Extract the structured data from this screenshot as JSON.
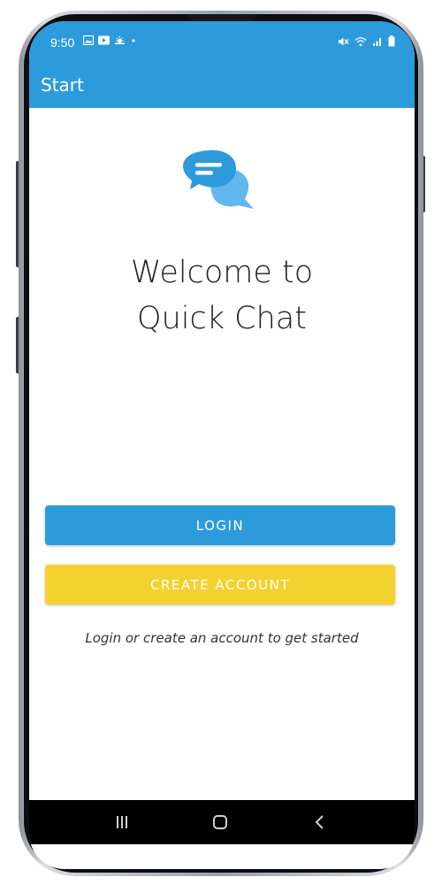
{
  "status_bar": {
    "time": "9:50",
    "icons_left": [
      "gallery-icon",
      "youtube-icon",
      "weather-icon",
      "dot-icon"
    ],
    "icons_right": [
      "mute-icon",
      "wifi-icon",
      "signal-icon",
      "battery-icon"
    ]
  },
  "app_bar": {
    "title": "Start"
  },
  "welcome": {
    "line1": "Welcome to",
    "line2": "Quick Chat"
  },
  "buttons": {
    "login_label": "LOGIN",
    "create_label": "CREATE ACCOUNT"
  },
  "helper_text": "Login or create an account to get started",
  "colors": {
    "primary": "#2D9BDB",
    "accent": "#F3D230",
    "logo_front": "#2D9BDB",
    "logo_back": "#62B8EE"
  },
  "nav_bar": {
    "icons": [
      "recent-apps-icon",
      "home-icon",
      "back-icon"
    ]
  }
}
